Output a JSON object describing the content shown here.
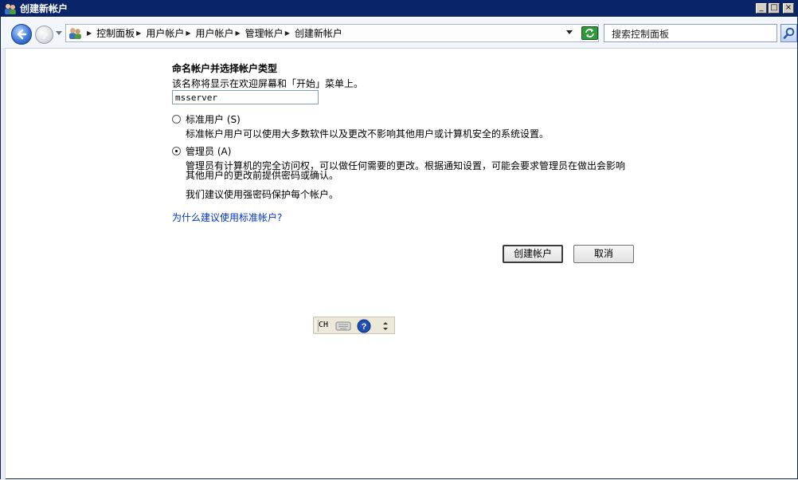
{
  "window": {
    "title": "创建新帐户",
    "controls": {
      "minimize": "_",
      "maximize": "□",
      "close": "×"
    }
  },
  "toolbar": {
    "breadcrumbs": [
      "控制面板",
      "用户帐户",
      "用户帐户",
      "管理帐户",
      "创建新帐户"
    ],
    "search_placeholder": "搜索控制面板"
  },
  "form": {
    "heading": "命名帐户并选择帐户类型",
    "description": "该名称将显示在欢迎屏幕和「开始」菜单上。",
    "name_value": "msserver",
    "options": [
      {
        "label": "标准用户 (S)",
        "selected": false,
        "description": "标准帐户用户可以使用大多数软件以及更改不影响其他用户或计算机安全的系统设置。"
      },
      {
        "label": "管理员 (A)",
        "selected": true,
        "description_line1": "管理员有计算机的完全访问权，可以做任何需要的更改。根据通知设置，可能会要求管理员在做出会影响",
        "description_line2": "其他用户的更改前提供密码或确认。",
        "note": "我们建议使用强密码保护每个帐户。"
      }
    ],
    "why_link": "为什么建议使用标准帐户?",
    "create_button": "创建帐户",
    "cancel_button": "取消"
  },
  "language_bar": {
    "input_language": "CH",
    "icons": [
      "keyboard-icon",
      "help-icon",
      "options-icon"
    ]
  },
  "colors": {
    "title_bar": "#0a246a",
    "link": "#0033cc",
    "refresh_green": "#2e9a3a"
  }
}
